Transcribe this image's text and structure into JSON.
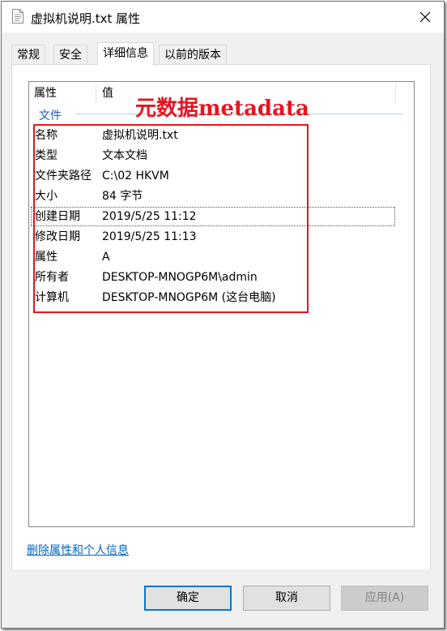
{
  "window": {
    "title": "虚拟机说明.txt 属性",
    "icon": "text-file-icon",
    "close_icon": "close-icon"
  },
  "tabs": [
    {
      "label": "常规",
      "active": false
    },
    {
      "label": "安全",
      "active": false
    },
    {
      "label": "详细信息",
      "active": true
    },
    {
      "label": "以前的版本",
      "active": false
    }
  ],
  "list": {
    "columns": {
      "property": "属性",
      "value": "值"
    },
    "group": "文件",
    "rows": [
      {
        "name": "名称",
        "value": "虚拟机说明.txt"
      },
      {
        "name": "类型",
        "value": "文本文档"
      },
      {
        "name": "文件夹路径",
        "value": "C:\\02 HKVM"
      },
      {
        "name": "大小",
        "value": "84 字节"
      },
      {
        "name": "创建日期",
        "value": "2019/5/25 11:12"
      },
      {
        "name": "修改日期",
        "value": "2019/5/25 11:13"
      },
      {
        "name": "属性",
        "value": "A"
      },
      {
        "name": "所有者",
        "value": "DESKTOP-MNOGP6M\\admin"
      },
      {
        "name": "计算机",
        "value": "DESKTOP-MNOGP6M (这台电脑)"
      }
    ],
    "focused_row": "创建日期"
  },
  "annotation": {
    "label": "元数据metadata",
    "color": "#e8141e"
  },
  "remove_link": "删除属性和个人信息",
  "buttons": {
    "ok": "确定",
    "cancel": "取消",
    "apply": "应用(A)"
  },
  "colors": {
    "link": "#0066cc",
    "group_header": "#1e5db3",
    "accent": "#0078d7"
  }
}
